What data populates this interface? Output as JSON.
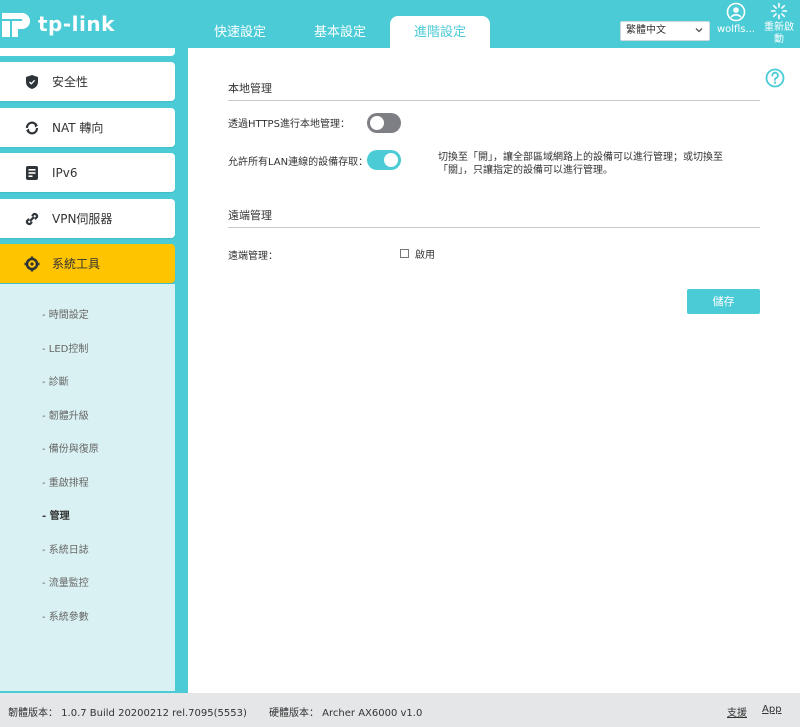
{
  "header": {
    "logo_text": "tp-link",
    "tabs": [
      {
        "label": "快速設定"
      },
      {
        "label": "基本設定"
      },
      {
        "label": "進階設定"
      }
    ],
    "language": "繁體中文",
    "user_label": "wolfls...",
    "reboot_label": "重新啟動"
  },
  "sidebar": {
    "items": [
      {
        "label": "安全性",
        "icon": "shield-icon"
      },
      {
        "label": "NAT 轉向",
        "icon": "nat-icon"
      },
      {
        "label": "IPv6",
        "icon": "ipv6-icon"
      },
      {
        "label": "VPN伺服器",
        "icon": "link-icon"
      },
      {
        "label": "系統工具",
        "icon": "gear-icon"
      }
    ],
    "submenu": [
      {
        "label": "- 時間設定"
      },
      {
        "label": "- LED控制"
      },
      {
        "label": "- 診斷"
      },
      {
        "label": "- 韌體升級"
      },
      {
        "label": "- 備份與復原"
      },
      {
        "label": "- 重啟排程"
      },
      {
        "label": "- 管理"
      },
      {
        "label": "- 系統日誌"
      },
      {
        "label": "- 流量監控"
      },
      {
        "label": "- 系統參數"
      }
    ]
  },
  "main": {
    "local_title": "本地管理",
    "https_label": "透過HTTPS進行本地管理：",
    "https_enabled": false,
    "lan_label": "允許所有LAN連線的設備存取：",
    "lan_enabled": true,
    "lan_hint": "切換至「開」，讓全部區域網路上的設備可以進行管理；或切換至「關」，只讓指定的設備可以進行管理。",
    "remote_title": "遠端管理",
    "remote_label": "遠端管理：",
    "remote_enable_label": "啟用",
    "remote_enabled": false,
    "save_label": "儲存"
  },
  "footer": {
    "firmware": "韌體版本： 1.0.7 Build 20200212 rel.7095(5553)",
    "hardware": "硬體版本： Archer AX6000 v1.0",
    "support": "支援",
    "app": "App"
  },
  "colors": {
    "accent": "#4acbd6",
    "active_menu": "#ffc400",
    "submenu_bg": "#daf1f3",
    "toggle_off": "#7d7f84",
    "footer_bg": "#e4e6e7"
  }
}
